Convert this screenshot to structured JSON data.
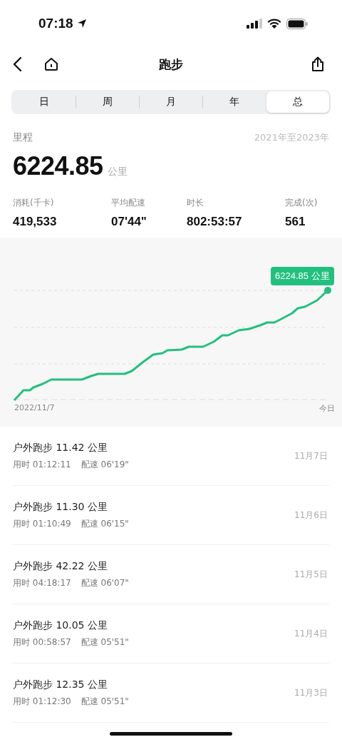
{
  "status_bar": {
    "time": "07:18"
  },
  "nav": {
    "title": "跑步"
  },
  "tabs": [
    {
      "label": "日",
      "selected": false
    },
    {
      "label": "周",
      "selected": false
    },
    {
      "label": "月",
      "selected": false
    },
    {
      "label": "年",
      "selected": false
    },
    {
      "label": "总",
      "selected": true
    }
  ],
  "summary": {
    "label": "里程",
    "range": "2021年至2023年",
    "value": "6224.85",
    "unit": "公里"
  },
  "stats": [
    {
      "label": "消耗(千卡)",
      "value": "419,533"
    },
    {
      "label": "平均配速",
      "value": "07'44\""
    },
    {
      "label": "时长",
      "value": "802:53:57"
    },
    {
      "label": "完成(次)",
      "value": "561"
    }
  ],
  "chart": {
    "tooltip": "6224.85 公里",
    "x_start": "2022/11/7",
    "x_end": "今日"
  },
  "records": [
    {
      "title": "户外跑步 11.42 公里",
      "duration": "用时 01:12:11",
      "pace": "配速 06'19\"",
      "date": "11月7日"
    },
    {
      "title": "户外跑步 11.30 公里",
      "duration": "用时 01:10:49",
      "pace": "配速 06'15\"",
      "date": "11月6日"
    },
    {
      "title": "户外跑步 42.22 公里",
      "duration": "用时 04:18:17",
      "pace": "配速 06'07\"",
      "date": "11月5日"
    },
    {
      "title": "户外跑步 10.05 公里",
      "duration": "用时 00:58:57",
      "pace": "配速 05'51\"",
      "date": "11月4日"
    },
    {
      "title": "户外跑步 12.35 公里",
      "duration": "用时 01:12:30",
      "pace": "配速 05'51\"",
      "date": "11月3日"
    }
  ]
}
